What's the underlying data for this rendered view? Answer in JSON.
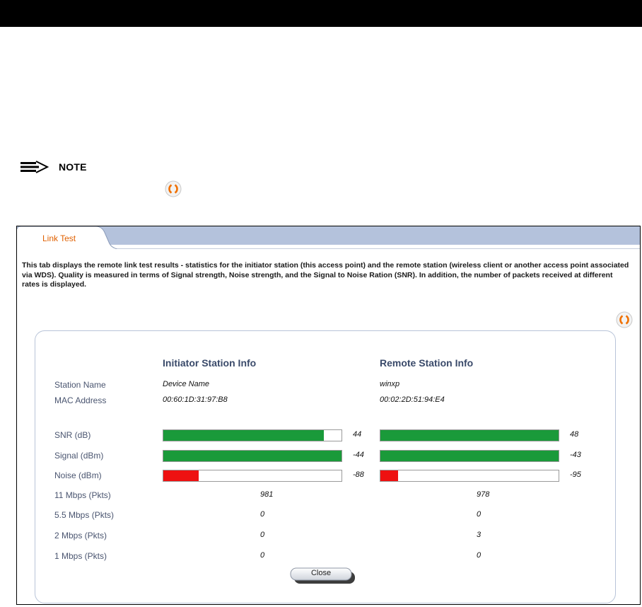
{
  "note": {
    "label": "NOTE"
  },
  "tab": {
    "label": "Link Test"
  },
  "description": "This tab displays the remote link test results - statistics for the initiator station (this access point) and the remote station (wireless client or another access point associated via WDS). Quality is measured in terms of Signal strength, Noise strength, and the Signal to Noise Ration (SNR). In addition, the number of packets received at different rates is displayed.",
  "columns": {
    "initiator": "Initiator Station Info",
    "remote": "Remote Station Info"
  },
  "labels": {
    "station_name": "Station Name",
    "mac_address": "MAC Address",
    "snr": "SNR (dB)",
    "signal": "Signal (dBm)",
    "noise": "Noise (dBm)",
    "r11": "11 Mbps (Pkts)",
    "r55": "5.5 Mbps (Pkts)",
    "r2": "2 Mbps (Pkts)",
    "r1": "1 Mbps (Pkts)"
  },
  "initiator": {
    "station_name": "Device Name",
    "mac_address": "00:60:1D:31:97:B8",
    "snr": "44",
    "snr_fill": 0.9,
    "signal": "-44",
    "signal_fill": 1.0,
    "noise": "-88",
    "noise_fill": 0.2,
    "r11": "981",
    "r55": "0",
    "r2": "0",
    "r1": "0"
  },
  "remote": {
    "station_name": "winxp",
    "mac_address": "00:02:2D:51:94:E4",
    "snr": "48",
    "snr_fill": 1.0,
    "signal": "-43",
    "signal_fill": 1.0,
    "noise": "-95",
    "noise_fill": 0.1,
    "r11": "978",
    "r55": "0",
    "r2": "3",
    "r1": "0"
  },
  "close_label": "Close",
  "colors": {
    "good": "#1a9a3a",
    "bad": "#ee1111",
    "tab_text": "#e06000",
    "refresh": "#f07000"
  },
  "icons": {
    "note": "note-arrow-icon",
    "refresh": "refresh-icon"
  }
}
